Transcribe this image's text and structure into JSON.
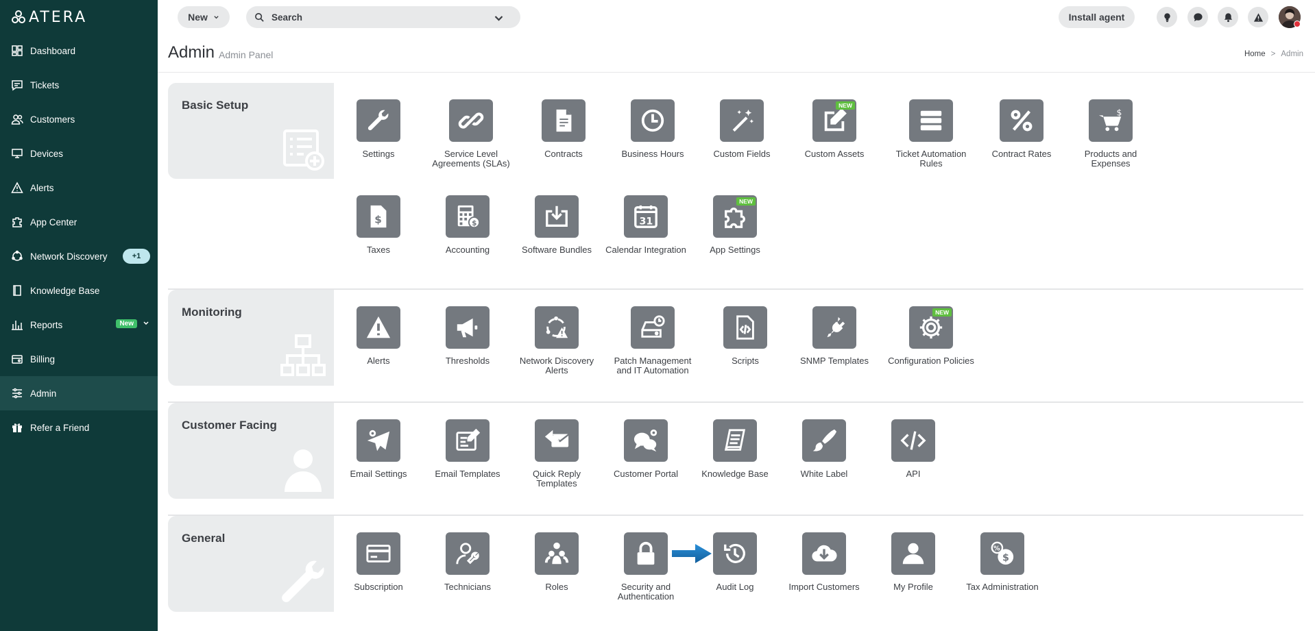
{
  "app": {
    "logo_text": "ATERA"
  },
  "sidebar": {
    "items": [
      {
        "label": "Dashboard",
        "icon": "dashboard-icon"
      },
      {
        "label": "Tickets",
        "icon": "tickets-icon"
      },
      {
        "label": "Customers",
        "icon": "customers-icon"
      },
      {
        "label": "Devices",
        "icon": "devices-icon"
      },
      {
        "label": "Alerts",
        "icon": "alerts-icon"
      },
      {
        "label": "App Center",
        "icon": "app-center-icon"
      },
      {
        "label": "Network Discovery",
        "icon": "network-discovery-icon",
        "badge": "+1"
      },
      {
        "label": "Knowledge Base",
        "icon": "knowledge-base-icon"
      },
      {
        "label": "Reports",
        "icon": "reports-icon",
        "new_badge": "New"
      },
      {
        "label": "Billing",
        "icon": "billing-icon"
      },
      {
        "label": "Admin",
        "icon": "admin-icon",
        "active": true
      },
      {
        "label": "Refer a Friend",
        "icon": "gift-icon"
      }
    ]
  },
  "topbar": {
    "new_label": "New",
    "search_placeholder": "Search",
    "install_label": "Install agent",
    "icons": [
      "lightbulb-icon",
      "chat-icon",
      "bell-icon",
      "warning-icon"
    ]
  },
  "header": {
    "title": "Admin",
    "subtitle": "Admin Panel",
    "breadcrumb": [
      "Home",
      ">",
      "Admin"
    ]
  },
  "sections": {
    "basic": {
      "title": "Basic Setup",
      "tiles": [
        {
          "label": "Settings",
          "icon": "wrench-icon"
        },
        {
          "label": "Service Level Agreements (SLAs)",
          "icon": "link-icon"
        },
        {
          "label": "Contracts",
          "icon": "contract-icon"
        },
        {
          "label": "Business Hours",
          "icon": "clock-icon"
        },
        {
          "label": "Custom Fields",
          "icon": "magic-wand-icon"
        },
        {
          "label": "Custom Assets",
          "icon": "edit-icon",
          "new": "NEW"
        },
        {
          "label": "Ticket Automation Rules",
          "icon": "server-icon"
        },
        {
          "label": "Contract Rates",
          "icon": "percent-icon"
        },
        {
          "label": "Products and Expenses",
          "icon": "cart-icon"
        },
        {
          "label": "Taxes",
          "icon": "tax-file-icon"
        },
        {
          "label": "Accounting",
          "icon": "calculator-icon"
        },
        {
          "label": "Software Bundles",
          "icon": "download-icon"
        },
        {
          "label": "Calendar Integration",
          "icon": "calendar-icon",
          "day": "31"
        },
        {
          "label": "App Settings",
          "icon": "puzzle-icon",
          "new": "NEW"
        }
      ]
    },
    "monitoring": {
      "title": "Monitoring",
      "tiles": [
        {
          "label": "Alerts",
          "icon": "alert-icon"
        },
        {
          "label": "Thresholds",
          "icon": "megaphone-icon"
        },
        {
          "label": "Network Discovery Alerts",
          "icon": "network-alert-icon"
        },
        {
          "label": "Patch Management and IT Automation",
          "icon": "patch-icon"
        },
        {
          "label": "Scripts",
          "icon": "script-icon"
        },
        {
          "label": "SNMP Templates",
          "icon": "plug-icon"
        },
        {
          "label": "Configuration Policies",
          "icon": "gear-icon",
          "new": "NEW"
        }
      ]
    },
    "customer": {
      "title": "Customer Facing",
      "tiles": [
        {
          "label": "Email Settings",
          "icon": "send-gear-icon"
        },
        {
          "label": "Email Templates",
          "icon": "template-edit-icon"
        },
        {
          "label": "Quick Reply Templates",
          "icon": "quick-reply-icon"
        },
        {
          "label": "Customer Portal",
          "icon": "portal-chat-icon"
        },
        {
          "label": "Knowledge Base",
          "icon": "book-icon"
        },
        {
          "label": "White Label",
          "icon": "brush-icon"
        },
        {
          "label": "API",
          "icon": "code-icon"
        }
      ]
    },
    "general": {
      "title": "General",
      "tiles": [
        {
          "label": "Subscription",
          "icon": "credit-card-icon"
        },
        {
          "label": "Technicians",
          "icon": "technician-icon"
        },
        {
          "label": "Roles",
          "icon": "roles-icon"
        },
        {
          "label": "Security and Authentication",
          "icon": "lock-icon"
        },
        {
          "label": "Audit Log",
          "icon": "history-icon"
        },
        {
          "label": "Import Customers",
          "icon": "cloud-download-icon"
        },
        {
          "label": "My Profile",
          "icon": "profile-icon"
        },
        {
          "label": "Tax Administration",
          "icon": "tax-admin-icon"
        }
      ]
    }
  },
  "colors": {
    "sidebar": "#0f3a39",
    "tile": "#74797f",
    "accent_arrow": "#1a7fc8",
    "new_badge": "#5fbf3f"
  }
}
